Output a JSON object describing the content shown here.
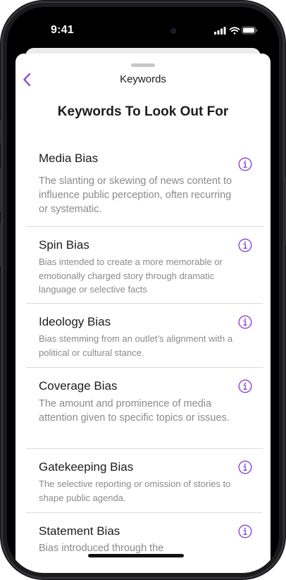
{
  "status_bar": {
    "time": "9:41"
  },
  "nav": {
    "back_icon": "chevron-left-icon",
    "title": "Keywords"
  },
  "page": {
    "title": "Keywords To Look Out For"
  },
  "colors": {
    "accent": "#8e4fd6",
    "title_text": "#1c1c1e",
    "description_text": "#8a8a8e",
    "divider": "#dcdcde"
  },
  "keywords": [
    {
      "title": "Media Bias",
      "description": "The slanting or skewing of news content to influence public perception, often recurring or systematic.",
      "icon": "info-icon"
    },
    {
      "title": "Spin Bias",
      "description": "Bias intended to create a more memorable or emotionally charged story through dramatic language or selective facts",
      "icon": "info-icon"
    },
    {
      "title": "Ideology Bias",
      "description": "Bias stemming from an outlet’s alignment with a political or cultural stance.",
      "icon": "info-icon"
    },
    {
      "title": "Coverage Bias",
      "description": "The amount and prominence of media attention given to specific topics or issues.",
      "icon": "info-icon"
    },
    {
      "title": "Gatekeeping Bias",
      "description": "The selective reporting or omission of stories to shape public agenda.",
      "icon": "info-icon"
    },
    {
      "title": "Statement Bias",
      "description": "Bias introduced through the",
      "icon": "info-icon"
    }
  ]
}
